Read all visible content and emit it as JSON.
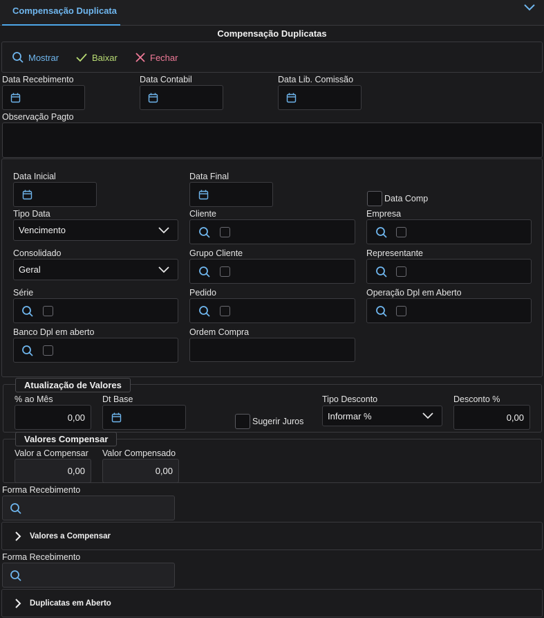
{
  "tab": {
    "label": "Compensação Duplicata"
  },
  "form": {
    "title": "Compensação Duplicatas"
  },
  "toolbar": {
    "mostrar": "Mostrar",
    "baixar": "Baixar",
    "fechar": "Fechar"
  },
  "top_fields": {
    "data_recebimento": "Data Recebimento",
    "data_contabil": "Data Contabil",
    "data_lib_comissao": "Data Lib. Comissão",
    "observacao": "Observação Pagto"
  },
  "filters": {
    "data_inicial": "Data Inicial",
    "data_final": "Data Final",
    "data_comp": "Data Comp",
    "tipo_data": {
      "label": "Tipo Data",
      "value": "Vencimento"
    },
    "cliente": "Cliente",
    "empresa": "Empresa",
    "consolidado": {
      "label": "Consolidado",
      "value": "Geral"
    },
    "grupo_cliente": "Grupo Cliente",
    "representante": "Representante",
    "serie": "Série",
    "pedido": "Pedido",
    "operacao_dpl": "Operação Dpl em Aberto",
    "banco_dpl": "Banco Dpl em aberto",
    "ordem_compra": "Ordem Compra"
  },
  "atualizacao": {
    "title": "Atualização de Valores",
    "perc_mes": {
      "label": "% ao Mês",
      "value": "0,00"
    },
    "dt_base": "Dt Base",
    "sugerir_juros": "Sugerir Juros",
    "tipo_desconto": {
      "label": "Tipo Desconto",
      "value": "Informar %"
    },
    "desconto": {
      "label": "Desconto %",
      "value": "0,00"
    }
  },
  "valores_compensar": {
    "title": "Valores Compensar",
    "valor_compensar": {
      "label": "Valor a Compensar",
      "value": "0,00"
    },
    "valor_compensado": {
      "label": "Valor Compensado",
      "value": "0,00"
    }
  },
  "forma_recebimento_1": "Forma Recebimento",
  "section_valores": "Valores a Compensar",
  "forma_recebimento_2": "Forma Recebimento",
  "section_duplicatas": "Duplicatas em Aberto",
  "colors": {
    "accent": "#6fb6ee",
    "check": "#b9dc74",
    "close": "#f07a98"
  },
  "icons": [
    "search-icon",
    "check-icon",
    "close-icon",
    "calendar-icon",
    "chevron-down-icon",
    "chevron-right-icon"
  ]
}
